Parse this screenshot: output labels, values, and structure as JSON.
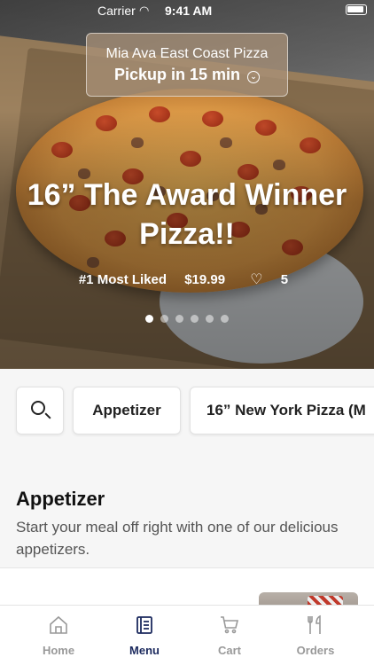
{
  "status_bar": {
    "carrier": "Carrier",
    "time": "9:41 AM"
  },
  "store": {
    "name": "Mia Ava East Coast Pizza",
    "pickup": "Pickup in 15 min"
  },
  "hero": {
    "title": "16” The Award Winner Pizza!!",
    "badge": "#1 Most Liked",
    "price": "$19.99",
    "likes": "5",
    "slides": 6,
    "active_slide": 1
  },
  "categories": {
    "search_icon": "search-icon",
    "items": [
      "Appetizer",
      "16” New York Pizza (M"
    ]
  },
  "section": {
    "title": "Appetizer",
    "description": "Start your meal off right with one of our delicious appetizers."
  },
  "tabbar": {
    "active": "Menu",
    "tabs": [
      {
        "label": "Home",
        "icon": "home-icon"
      },
      {
        "label": "Menu",
        "icon": "menu-book-icon"
      },
      {
        "label": "Cart",
        "icon": "cart-icon"
      },
      {
        "label": "Orders",
        "icon": "utensils-icon"
      }
    ]
  },
  "colors": {
    "accent": "#1c2a5e",
    "inactive_tab": "#999999"
  }
}
